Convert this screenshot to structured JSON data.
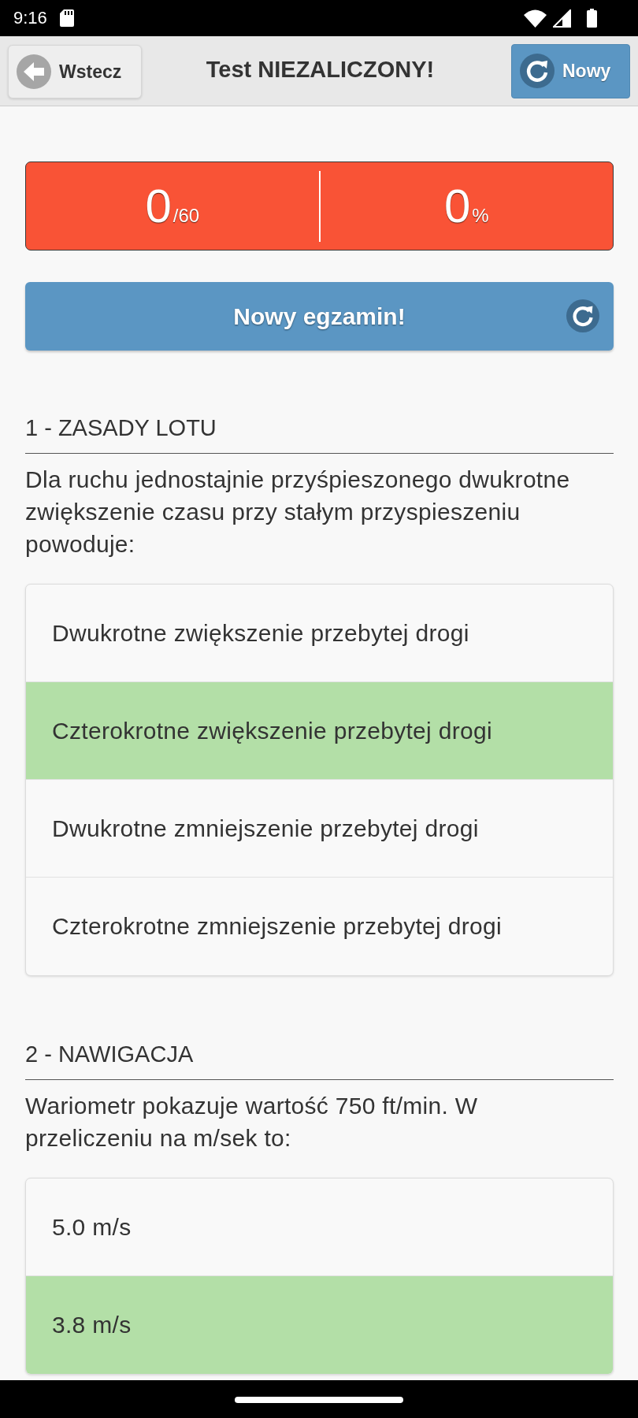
{
  "status_bar": {
    "time": "9:16"
  },
  "header": {
    "back_button": {
      "label": "Wstecz"
    },
    "title": "Test NIEZALICZONY!",
    "new_button": {
      "label": "Nowy"
    }
  },
  "score": {
    "passed": false,
    "points": "0",
    "points_max": "/60",
    "percent": "0",
    "percent_unit": "%"
  },
  "new_exam_button": {
    "label": "Nowy egzamin!"
  },
  "questions": [
    {
      "heading": "1 - ZASADY LOTU",
      "text": "Dla ruchu jednostajnie przyśpieszonego dwukrotne zwiększenie czasu przy stałym przyspieszeniu powoduje:",
      "answers": [
        {
          "text": "Dwukrotne zwiększenie przebytej drogi",
          "correct": false
        },
        {
          "text": "Czterokrotne zwiększenie przebytej drogi",
          "correct": true
        },
        {
          "text": "Dwukrotne zmniejszenie przebytej drogi",
          "correct": false
        },
        {
          "text": "Czterokrotne zmniejszenie przebytej drogi",
          "correct": false
        }
      ]
    },
    {
      "heading": "2 - NAWIGACJA",
      "text": "Wariometr pokazuje wartość 750 ft/min. W przeliczeniu na m/sek to:",
      "answers": [
        {
          "text": "5.0 m/s",
          "correct": false
        },
        {
          "text": "3.8 m/s",
          "correct": true
        }
      ]
    }
  ]
}
